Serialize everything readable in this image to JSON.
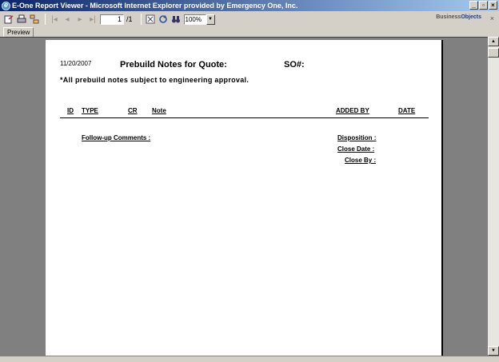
{
  "window": {
    "title": "E-One Report Viewer - Microsoft Internet Explorer provided by Emergency One, Inc.",
    "controls": {
      "minimize": "_",
      "restore": "▫",
      "close": "×"
    }
  },
  "toolbar": {
    "current_page": "1",
    "total_pages": "/1",
    "zoom": "100%",
    "brand_prefix": "Business",
    "brand_suffix": "Objects",
    "close_label": "×"
  },
  "tabs": [
    {
      "label": "Preview"
    }
  ],
  "report": {
    "date": "11/20/2007",
    "title": "Prebuild Notes for Quote:",
    "so_label": "SO#:",
    "approval_note": "*All prebuild notes subject to engineering approval.",
    "columns": {
      "id": "ID",
      "type": "TYPE",
      "cr": "CR",
      "note": "Note",
      "added_by": "ADDED BY",
      "date": "DATE"
    },
    "followup_label": "Follow-up Comments :",
    "disposition_label": "Disposition :",
    "close_date_label": "Close Date :",
    "close_by_label": "Close By :"
  }
}
